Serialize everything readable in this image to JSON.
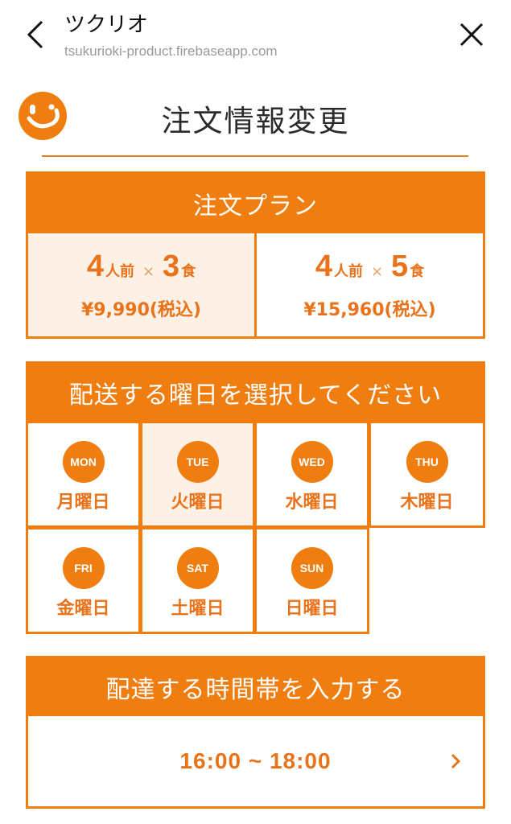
{
  "browser": {
    "title": "ツクリオ",
    "url": "tsukurioki-product.firebaseapp.com",
    "back_icon": "chevron-left-icon",
    "close_icon": "close-icon"
  },
  "page": {
    "title": "注文情報変更",
    "logo_icon": "smile-logo-icon",
    "accent_color": "#ef7d0f"
  },
  "plan": {
    "heading": "注文プラン",
    "options": [
      {
        "people": "4",
        "people_unit": "人前",
        "times": "×",
        "meals": "3",
        "meals_unit": "食",
        "price": "¥9,990(税込)",
        "selected": true
      },
      {
        "people": "4",
        "people_unit": "人前",
        "times": "×",
        "meals": "5",
        "meals_unit": "食",
        "price": "¥15,960(税込)",
        "selected": false
      }
    ]
  },
  "days": {
    "heading": "配送する曜日を選択してください",
    "items": [
      {
        "abbr": "MON",
        "label": "月曜日",
        "selected": false
      },
      {
        "abbr": "TUE",
        "label": "火曜日",
        "selected": true
      },
      {
        "abbr": "WED",
        "label": "水曜日",
        "selected": false
      },
      {
        "abbr": "THU",
        "label": "木曜日",
        "selected": false
      },
      {
        "abbr": "FRI",
        "label": "金曜日",
        "selected": false
      },
      {
        "abbr": "SAT",
        "label": "土曜日",
        "selected": false
      },
      {
        "abbr": "SUN",
        "label": "日曜日",
        "selected": false
      }
    ]
  },
  "time": {
    "heading": "配達する時間帯を入力する",
    "value": "16:00 ~ 18:00",
    "chevron_icon": "chevron-right-icon"
  }
}
